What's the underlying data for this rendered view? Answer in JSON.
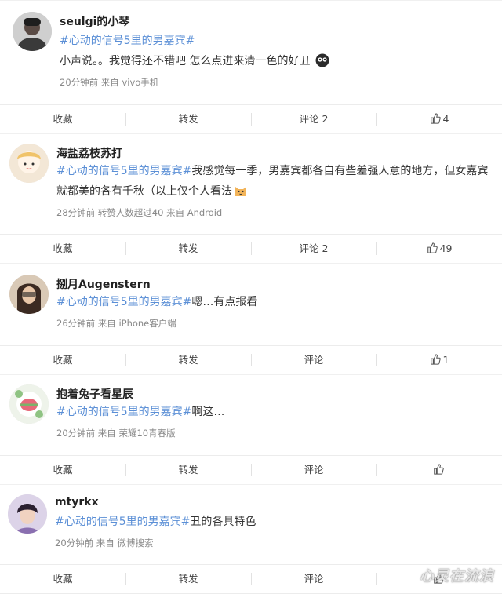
{
  "posts": [
    {
      "username": "seulgi的小琴",
      "topic": "#心动的信号5里的男嘉宾#",
      "text_before": "",
      "text": "小声说。。我觉得还不错吧 怎么点进来清一色的好丑",
      "emoji": "dark-face-emoji",
      "meta": "20分钟前  来自 vivo手机",
      "actions": {
        "favorite": "收藏",
        "repost": "转发",
        "comment": "评论 2",
        "likes": "4"
      }
    },
    {
      "username": "海盐荔枝苏打",
      "topic": "#心动的信号5里的男嘉宾#",
      "text": "我感觉每一季，男嘉宾都各自有些差强人意的地方，但女嘉宾就都美的各有千秋（以上仅个人看法",
      "emoji": "cat-face-emoji",
      "meta": "28分钟前  转赞人数超过40  来自 Android",
      "actions": {
        "favorite": "收藏",
        "repost": "转发",
        "comment": "评论 2",
        "likes": "49"
      }
    },
    {
      "username": "捌月Augenstern",
      "topic": "#心动的信号5里的男嘉宾#",
      "text": "嗯…有点报看",
      "meta": "26分钟前  来自 iPhone客户端",
      "actions": {
        "favorite": "收藏",
        "repost": "转发",
        "comment": "评论",
        "likes": "1"
      }
    },
    {
      "username": "抱着兔子看星辰",
      "topic": "#心动的信号5里的男嘉宾#",
      "text": "啊这…",
      "meta": "20分钟前  来自 荣耀10青春版",
      "actions": {
        "favorite": "收藏",
        "repost": "转发",
        "comment": "评论",
        "likes": ""
      }
    },
    {
      "username": "mtyrkx",
      "topic": "#心动的信号5里的男嘉宾#",
      "text": "丑的各具特色",
      "meta": "20分钟前  来自 微博搜索",
      "actions": {
        "favorite": "收藏",
        "repost": "转发",
        "comment": "评论",
        "likes": ""
      }
    }
  ],
  "watermark": "心灵在流浪",
  "colors": {
    "topic": "#5b8fd6",
    "meta": "#888888",
    "divider": "#ececec"
  }
}
